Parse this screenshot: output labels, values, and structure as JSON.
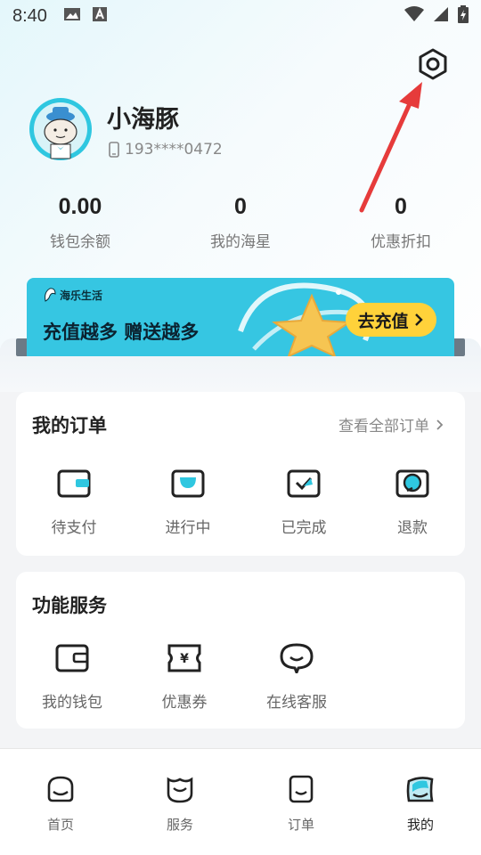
{
  "status_bar": {
    "time": "8:40"
  },
  "profile": {
    "username": "小海豚",
    "phone": "193****0472"
  },
  "stats": [
    {
      "value": "0.00",
      "label": "钱包余额"
    },
    {
      "value": "0",
      "label": "我的海星"
    },
    {
      "value": "0",
      "label": "优惠折扣"
    }
  ],
  "banner": {
    "logo_name": "海乐生活",
    "headline": "充值越多 赠送越多",
    "button_label": "去充值"
  },
  "orders": {
    "title": "我的订单",
    "view_all": "查看全部订单",
    "items": [
      {
        "label": "待支付",
        "icon": "wallet-card-icon"
      },
      {
        "label": "进行中",
        "icon": "in-progress-icon"
      },
      {
        "label": "已完成",
        "icon": "check-box-icon"
      },
      {
        "label": "退款",
        "icon": "refund-icon"
      }
    ]
  },
  "services": {
    "title": "功能服务",
    "items": [
      {
        "label": "我的钱包",
        "icon": "wallet-icon"
      },
      {
        "label": "优惠券",
        "icon": "coupon-icon"
      },
      {
        "label": "在线客服",
        "icon": "chat-icon"
      }
    ]
  },
  "tabbar": {
    "items": [
      {
        "label": "首页",
        "icon": "home-icon"
      },
      {
        "label": "服务",
        "icon": "service-icon"
      },
      {
        "label": "订单",
        "icon": "order-icon"
      },
      {
        "label": "我的",
        "icon": "profile-icon"
      }
    ],
    "active_index": 3
  },
  "colors": {
    "accent": "#36c6e2",
    "button_yellow": "#ffd23a",
    "arrow_red": "#e63b3b"
  }
}
